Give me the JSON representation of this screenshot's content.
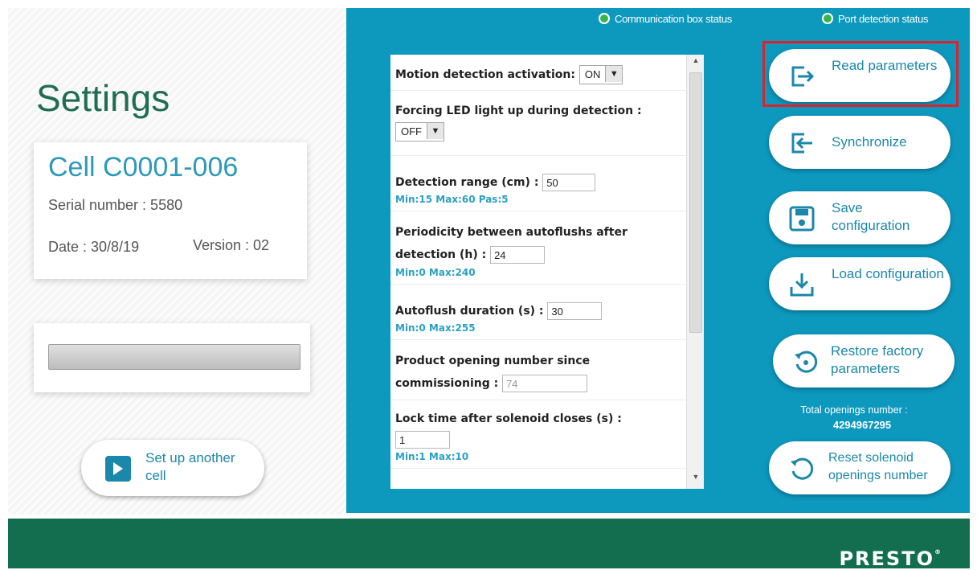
{
  "left": {
    "title": "Settings",
    "cell_name": "Cell C0001-006",
    "serial": "Serial number : 5580",
    "date": "Date : 30/8/19",
    "version": "Version :  02",
    "progress": 0,
    "setup_label": "Set up another cell"
  },
  "status": {
    "communication": "Communication box status",
    "port": "Port detection status",
    "indicator_color": "#3ab34a"
  },
  "params": {
    "motion": {
      "label": "Motion detection activation:",
      "value": "ON"
    },
    "led": {
      "label": "Forcing LED light up during detection :",
      "value": "OFF"
    },
    "range": {
      "label": "Detection range (cm) :",
      "value": "50",
      "hint": "Min:15 Max:60 Pas:5"
    },
    "periodicity": {
      "label": "Periodicity between autoflushs after detection (h) :",
      "value": "24",
      "hint": "Min:0 Max:240"
    },
    "autoflush": {
      "label": "Autoflush duration (s) :",
      "value": "30",
      "hint": "Min:0 Max:255"
    },
    "opening": {
      "label": "Product opening number since commissioning :",
      "value": "74"
    },
    "lock": {
      "label": "Lock time after solenoid closes (s) :",
      "value": "1",
      "hint": "Min:1 Max:10"
    }
  },
  "actions": {
    "read": "Read parameters",
    "sync": "Synchronize",
    "save": "Save configuration",
    "load": "Load configuration",
    "restore": "Restore factory parameters",
    "total_label": "Total openings number :",
    "total_value": "4294967295",
    "reset": "Reset solenoid openings number"
  },
  "brand": {
    "logo": "PRESTO",
    "reg": "®"
  },
  "colors": {
    "accent": "#0d98be",
    "footer": "#126e4e",
    "title": "#1f6d54",
    "highlight": "#e0202a"
  }
}
